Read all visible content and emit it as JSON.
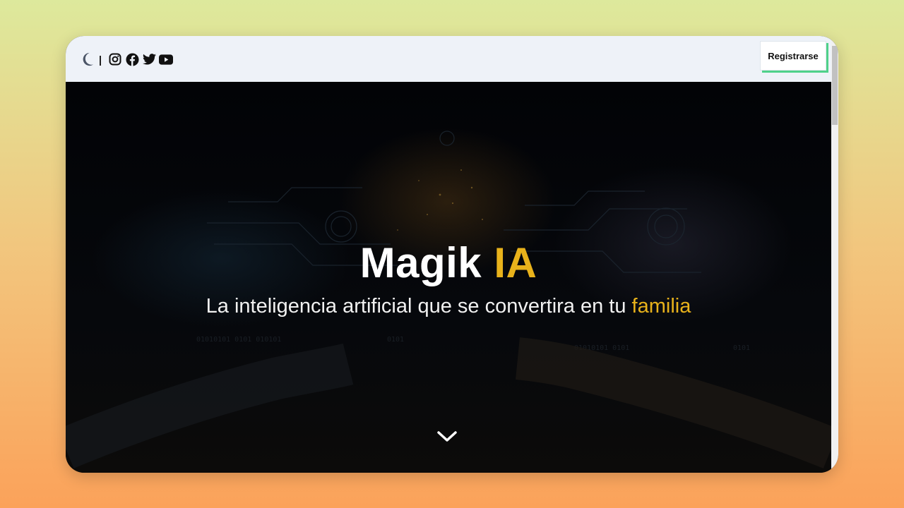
{
  "header": {
    "register_label": "Registrarse",
    "separator": "|",
    "icons": [
      "moon-icon",
      "instagram-icon",
      "facebook-icon",
      "twitter-icon",
      "youtube-icon"
    ]
  },
  "hero": {
    "title_main": "Magik",
    "title_accent": "IA",
    "subtitle_main": "La inteligencia artificial que se convertira en tu",
    "subtitle_accent": "familia",
    "scroll_icon": "chevron-down-icon"
  },
  "colors": {
    "accent": "#e8b21b",
    "header_bg": "#eef2f8",
    "button_shadow": "#4fd18a",
    "page_gradient_top": "#dde99c",
    "page_gradient_bottom": "#fba25a"
  }
}
